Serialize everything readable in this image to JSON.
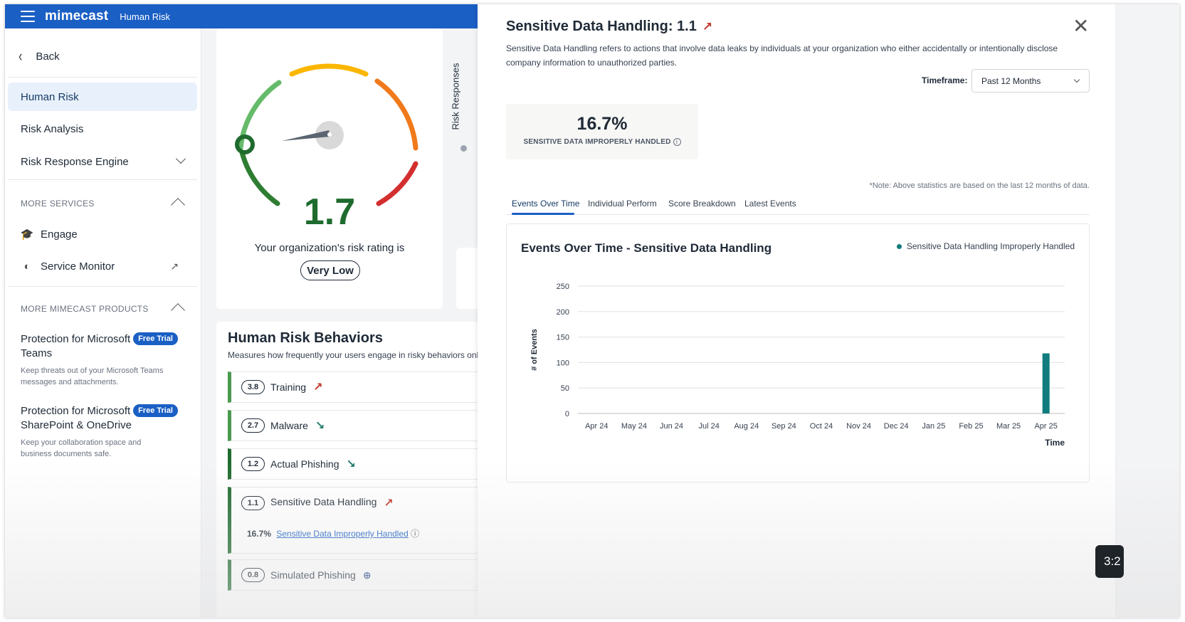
{
  "topbar": {
    "brand": "mimecast",
    "section": "Human Risk"
  },
  "sidebar": {
    "back_label": "Back",
    "nav": [
      {
        "label": "Human Risk",
        "active": true
      },
      {
        "label": "Risk Analysis",
        "active": false
      },
      {
        "label": "Risk Response Engine",
        "active": false
      }
    ],
    "more_services_label": "MORE SERVICES",
    "services": [
      {
        "label": "Engage",
        "icon": "graduation-cap-icon"
      },
      {
        "label": "Service Monitor",
        "icon": "monitor-gauge-icon",
        "external": true
      }
    ],
    "more_products_label": "MORE MIMECAST PRODUCTS",
    "products": [
      {
        "title": "Protection for Microsoft Teams",
        "badge": "Free Trial",
        "description": "Keep threats out of your Microsoft Teams messages and attachments."
      },
      {
        "title": "Protection for Microsoft SharePoint & OneDrive",
        "badge": "Free Trial",
        "description": "Keep your collaboration space and business documents safe."
      }
    ]
  },
  "gauge": {
    "value": "1.7",
    "caption": "Your organization's risk rating is",
    "rating": "Very Low"
  },
  "risk_responses_label": "Risk Responses",
  "behaviors": {
    "title": "Human Risk Behaviors",
    "description": "Measures how frequently your users engage in risky behaviors onli",
    "items": [
      {
        "score": "3.8",
        "name": "Training",
        "trend": "up"
      },
      {
        "score": "2.7",
        "name": "Malware",
        "trend": "down"
      },
      {
        "score": "1.2",
        "name": "Actual Phishing",
        "trend": "down"
      },
      {
        "score": "1.1",
        "name": "Sensitive Data Handling",
        "trend": "up",
        "sub_value": "16.7%",
        "sub_link": "Sensitive Data Improperly Handled"
      },
      {
        "score": "0.8",
        "name": "Simulated Phishing",
        "trend": "flat"
      }
    ]
  },
  "panel": {
    "title": "Sensitive Data Handling: 1.1",
    "description": "Sensitive Data Handling refers to actions that involve data leaks by individuals at your organization who either accidentally or intentionally disclose company information to unauthorized parties.",
    "timeframe_label": "Timeframe:",
    "timeframe_value": "Past 12 Months",
    "stat_value": "16.7%",
    "stat_label": "SENSITIVE DATA IMPROPERLY HANDLED",
    "note": "*Note: Above statistics are based on the last 12 months of data.",
    "tabs": [
      {
        "label": "Events Over Time",
        "active": true
      },
      {
        "label": "Individual Perform",
        "active": false
      },
      {
        "label": "Score Breakdown",
        "active": false
      },
      {
        "label": "Latest Events",
        "active": false
      }
    ],
    "chart_title": "Events Over Time - Sensitive Data Handling",
    "video_time": "3:2"
  },
  "colors": {
    "brand_blue": "#1a5fc4",
    "teal_bar": "#107c7c",
    "trend_up": "#c0392b",
    "trend_down": "#1f7a6b"
  },
  "chart_data": {
    "type": "bar",
    "title": "Events Over Time - Sensitive Data Handling",
    "xlabel": "Time",
    "ylabel": "# of Events",
    "ylim": [
      0,
      250
    ],
    "yticks": [
      0,
      50,
      100,
      150,
      200,
      250
    ],
    "categories": [
      "Apr 24",
      "May 24",
      "Jun 24",
      "Jul 24",
      "Aug 24",
      "Sep 24",
      "Oct 24",
      "Nov 24",
      "Dec 24",
      "Jan 25",
      "Feb 25",
      "Mar 25",
      "Apr 25"
    ],
    "series": [
      {
        "name": "Sensitive Data Handling Improperly Handled",
        "values": [
          0,
          0,
          0,
          0,
          0,
          0,
          0,
          0,
          0,
          0,
          0,
          0,
          118
        ]
      }
    ],
    "legend": "top-right",
    "grid": true
  }
}
